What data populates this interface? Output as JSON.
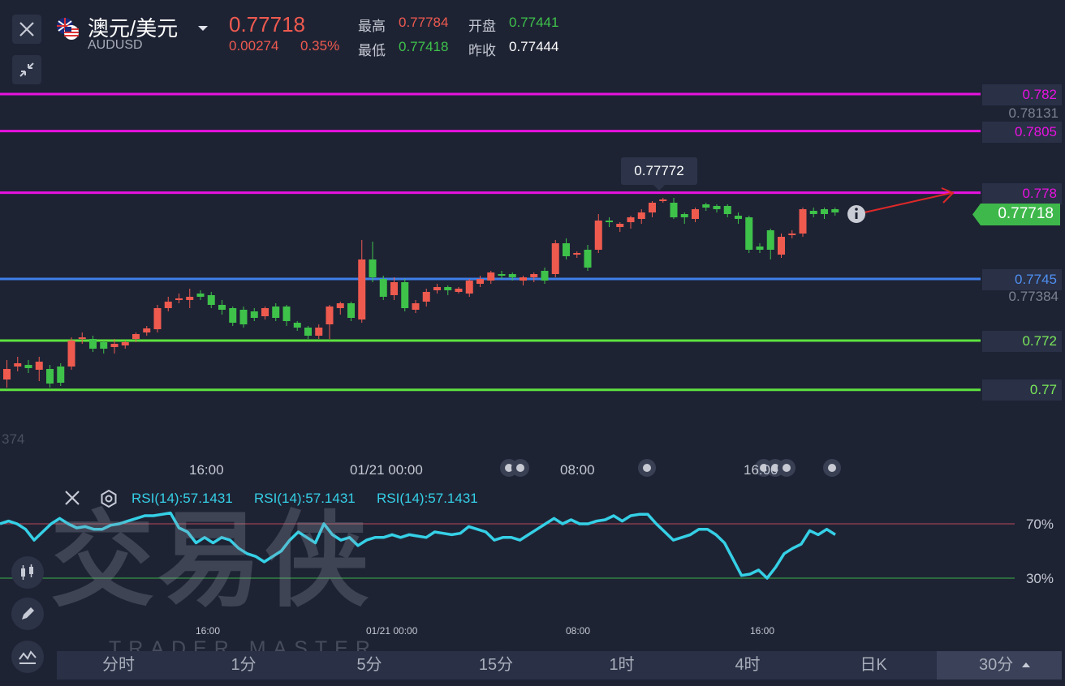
{
  "header": {
    "symbol_name": "澳元/美元",
    "symbol_code": "AUDUSD",
    "last_price": "0.77718",
    "change": "0.00274",
    "change_pct": "0.35%",
    "high_label": "最高",
    "high_value": "0.77784",
    "low_label": "最低",
    "low_value": "0.77418",
    "open_label": "开盘",
    "open_value": "0.77441",
    "prev_close_label": "昨收",
    "prev_close_value": "0.77444"
  },
  "price_levels": [
    {
      "label": "0.782",
      "color": "#e812e0"
    },
    {
      "label": "0.7805",
      "color": "#e812e0"
    },
    {
      "label": "0.778",
      "color": "#e812e0"
    },
    {
      "label": "0.7745",
      "color": "#3f7fe8"
    },
    {
      "label": "0.772",
      "color": "#5ee23e"
    },
    {
      "label": "0.77",
      "color": "#5ee23e"
    }
  ],
  "scale_gray": {
    "top": "0.78131",
    "bottom": "0.77384",
    "left_partial": "374"
  },
  "current_price_tag": "0.77718",
  "max_tooltip": "0.77772",
  "time_axis": [
    "16:00",
    "01/21 00:00",
    "08:00",
    "16:00"
  ],
  "rsi": {
    "labels": [
      "RSI(14):57.1431",
      "RSI(14):57.1431",
      "RSI(14):57.1431"
    ],
    "level_high": "70%",
    "level_low": "30%",
    "color": "#35d0e6",
    "values": [
      70,
      72,
      70,
      66,
      58,
      64,
      70,
      74,
      70,
      67,
      68,
      66,
      66,
      69,
      70,
      72,
      74,
      76,
      76,
      77,
      78,
      67,
      64,
      56,
      60,
      56,
      60,
      58,
      52,
      48,
      46,
      42,
      46,
      50,
      58,
      64,
      60,
      56,
      70,
      62,
      58,
      60,
      54,
      58,
      60,
      60,
      62,
      60,
      62,
      61,
      60,
      64,
      63,
      62,
      63,
      68,
      66,
      64,
      58,
      60,
      60,
      58,
      62,
      66,
      70,
      74,
      70,
      73,
      70,
      70,
      72,
      73,
      76,
      72,
      76,
      77,
      77,
      70,
      64,
      58,
      60,
      62,
      66,
      66,
      62,
      56,
      44,
      32,
      33,
      36,
      30,
      38,
      48,
      52,
      55,
      65,
      62,
      66,
      62
    ]
  },
  "bottom_watermark": {
    "logo": "交易侠",
    "sub": "TRADER MASTER"
  },
  "timeframes": {
    "items": [
      "分时",
      "1分",
      "5分",
      "15分",
      "1时",
      "4时",
      "日K"
    ],
    "active": "30分"
  },
  "colors": {
    "up": "#ef5a4f",
    "down": "#3ec24a",
    "bg": "#1e2334"
  }
}
